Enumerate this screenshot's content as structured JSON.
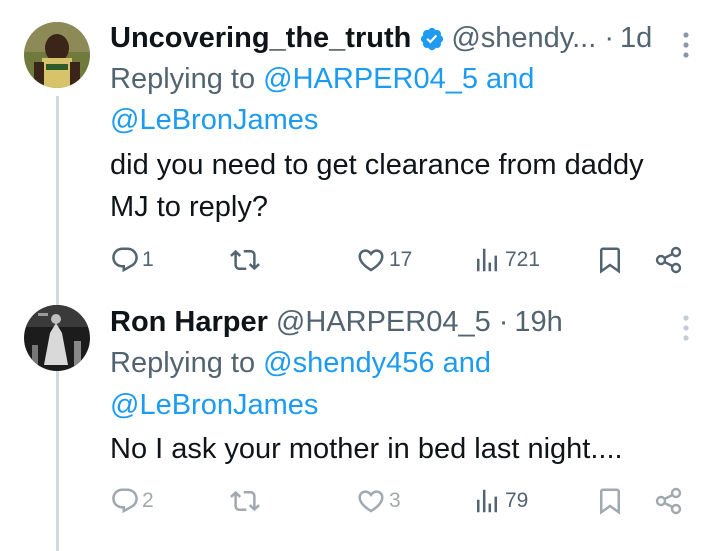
{
  "tweets": [
    {
      "name": "Uncovering_the_truth",
      "verified": true,
      "handle": "@shendy...",
      "separator": "·",
      "time": "1d",
      "replying_prefix": "Replying to",
      "replying_mention_1": "@HARPER04_5",
      "replying_and": "and",
      "replying_mention_2": "@LeBronJames",
      "text_line_1": "did you need to get clearance from daddy",
      "text_line_2": "MJ to reply?",
      "replies": "1",
      "reposts": "",
      "likes": "17",
      "views": "721"
    },
    {
      "name": "Ron Harper",
      "verified": false,
      "handle": "@HARPER04_5",
      "separator": "·",
      "time": "19h",
      "replying_prefix": "Replying to",
      "replying_mention_1": "@shendy456",
      "replying_and": "and",
      "replying_mention_2": "@LeBronJames",
      "text_line_1": "No I ask your mother in bed last night....",
      "replies": "2",
      "reposts": "",
      "likes": "3",
      "views": "79"
    }
  ],
  "colors": {
    "accent": "#1d9bf0",
    "secondary_text": "#536471",
    "primary_text": "#0f1419",
    "thread_line": "#cfd9de"
  },
  "icons": [
    "reply-icon",
    "repost-icon",
    "like-icon",
    "views-icon",
    "bookmark-icon",
    "share-icon",
    "more-icon",
    "verified-badge-icon"
  ]
}
